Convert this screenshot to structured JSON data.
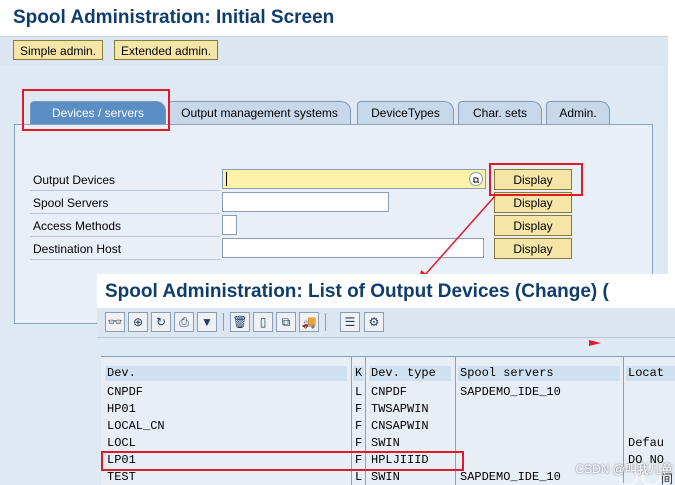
{
  "main": {
    "title": "Spool Administration: Initial Screen",
    "toolbar": {
      "simple_admin": "Simple admin.",
      "extended_admin": "Extended admin."
    },
    "tabs": [
      "Devices / servers",
      "Output management systems",
      "DeviceTypes",
      "Char. sets",
      "Admin."
    ],
    "fields": {
      "output_devices": "Output Devices",
      "spool_servers": "Spool Servers",
      "access_methods": "Access Methods",
      "destination_host": "Destination Host",
      "display": "Display"
    }
  },
  "overlay": {
    "title": "Spool Administration: List of Output Devices  (Change) (",
    "columns": [
      "Dev.",
      "K",
      "Dev. type",
      "Spool servers",
      "Locat"
    ],
    "rows": [
      [
        "CNPDF",
        "L",
        "CNPDF",
        "SAPDEMO_IDE_10",
        ""
      ],
      [
        "HP01",
        "F",
        "TWSAPWIN",
        "",
        ""
      ],
      [
        "LOCAL_CN",
        "F",
        "CNSAPWIN",
        "",
        ""
      ],
      [
        "LOCL",
        "F",
        "SWIN",
        "",
        "Defau"
      ],
      [
        "LP01",
        "F",
        "HPLJIIID",
        "",
        "DO NO"
      ],
      [
        "TEST",
        "L",
        "SWIN",
        "SAPDEMO_IDE_10",
        ""
      ]
    ],
    "watermark": "CSDN @叫我儿童",
    "corner_text": "间"
  },
  "colors": {
    "title": "#0f3d6e",
    "highlight": "#e0192b",
    "button": "#f5e6a8",
    "tab_active": "#5b8ec4"
  }
}
